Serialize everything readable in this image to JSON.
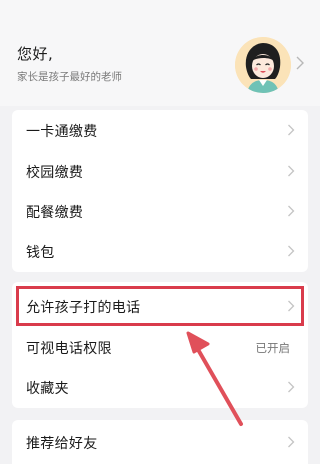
{
  "profile": {
    "greeting": "您好,",
    "subtitle": "家长是孩子最好的老师"
  },
  "menu_group_1": [
    {
      "label": "一卡通缴费"
    },
    {
      "label": "校园缴费"
    },
    {
      "label": "配餐缴费"
    },
    {
      "label": "钱包"
    }
  ],
  "menu_group_2": [
    {
      "label": "允许孩子打的电话"
    },
    {
      "label": "可视电话权限",
      "value": "已开启"
    },
    {
      "label": "收藏夹"
    }
  ],
  "menu_group_3": [
    {
      "label": "推荐给好友"
    }
  ],
  "colors": {
    "highlight": "#d93b4b",
    "arrow": "#e0505a",
    "background": "#f2f2f4"
  },
  "icons": {
    "chevron": "chevron-right-icon",
    "avatar": "teacher-avatar"
  }
}
